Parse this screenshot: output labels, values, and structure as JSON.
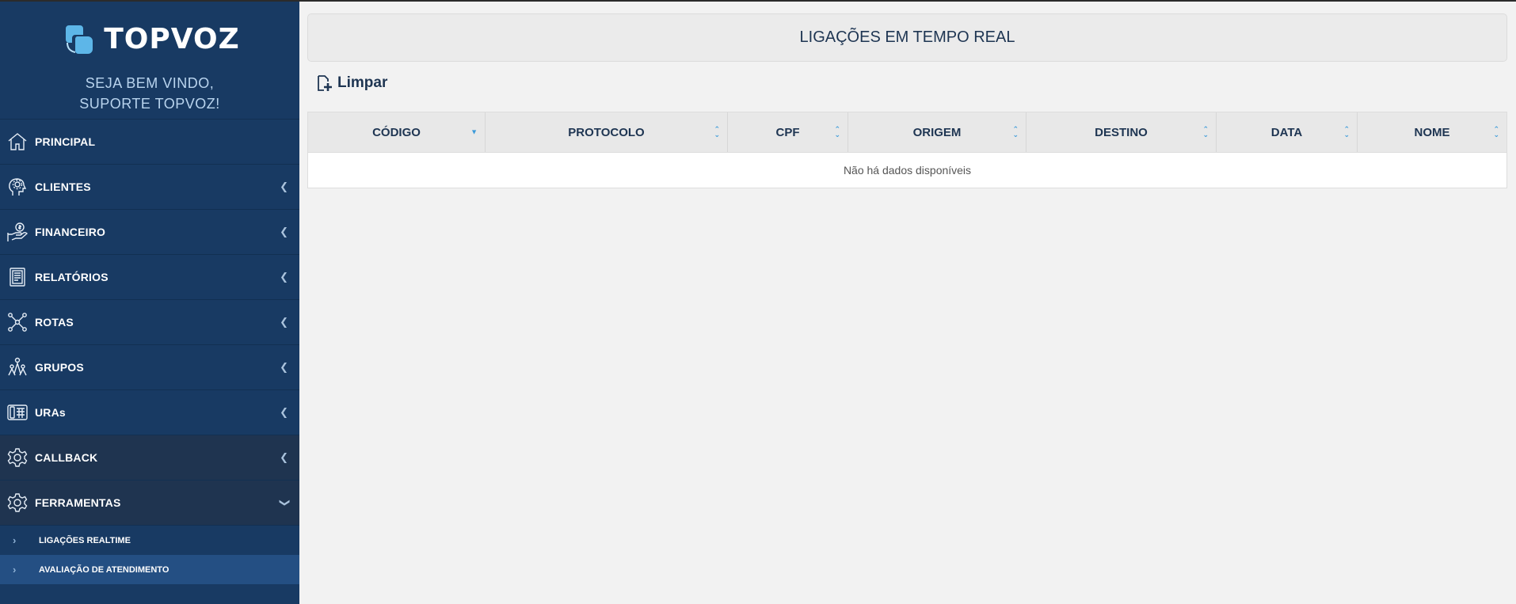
{
  "brand": {
    "logo_text": "TOPVOZ",
    "welcome_line1": "SEJA BEM VINDO,",
    "welcome_line2": "SUPORTE TOPVOZ!"
  },
  "sidebar": {
    "items": [
      {
        "label": "PRINCIPAL",
        "icon": "home-icon",
        "has_arrow": false
      },
      {
        "label": "CLIENTES",
        "icon": "head-gear-icon",
        "has_arrow": true
      },
      {
        "label": "FINANCEIRO",
        "icon": "money-hand-icon",
        "has_arrow": true
      },
      {
        "label": "RELATÓRIOS",
        "icon": "report-icon",
        "has_arrow": true
      },
      {
        "label": "ROTAS",
        "icon": "network-icon",
        "has_arrow": true
      },
      {
        "label": "GRUPOS",
        "icon": "group-icon",
        "has_arrow": true
      },
      {
        "label": "URAs",
        "icon": "phone-keypad-icon",
        "has_arrow": true
      },
      {
        "label": "CALLBACK",
        "icon": "gear-icon",
        "has_arrow": true
      },
      {
        "label": "FERRAMENTAS",
        "icon": "gear-icon",
        "has_arrow": true,
        "expanded": true
      }
    ],
    "subitems": [
      {
        "label": "LIGAÇÕES REALTIME"
      },
      {
        "label": "AVALIAÇÃO DE ATENDIMENTO",
        "active": true
      }
    ]
  },
  "main": {
    "title": "LIGAÇÕES EM TEMPO REAL",
    "clear_button": "Limpar",
    "table": {
      "columns": [
        "CÓDIGO",
        "PROTOCOLO",
        "CPF",
        "ORIGEM",
        "DESTINO",
        "DATA",
        "NOME"
      ],
      "sorted_column": "CÓDIGO",
      "empty_text": "Não há dados disponíveis"
    }
  },
  "colors": {
    "sidebar": "#183a63",
    "accent": "#3a9ad9",
    "title_text": "#1e3552"
  }
}
